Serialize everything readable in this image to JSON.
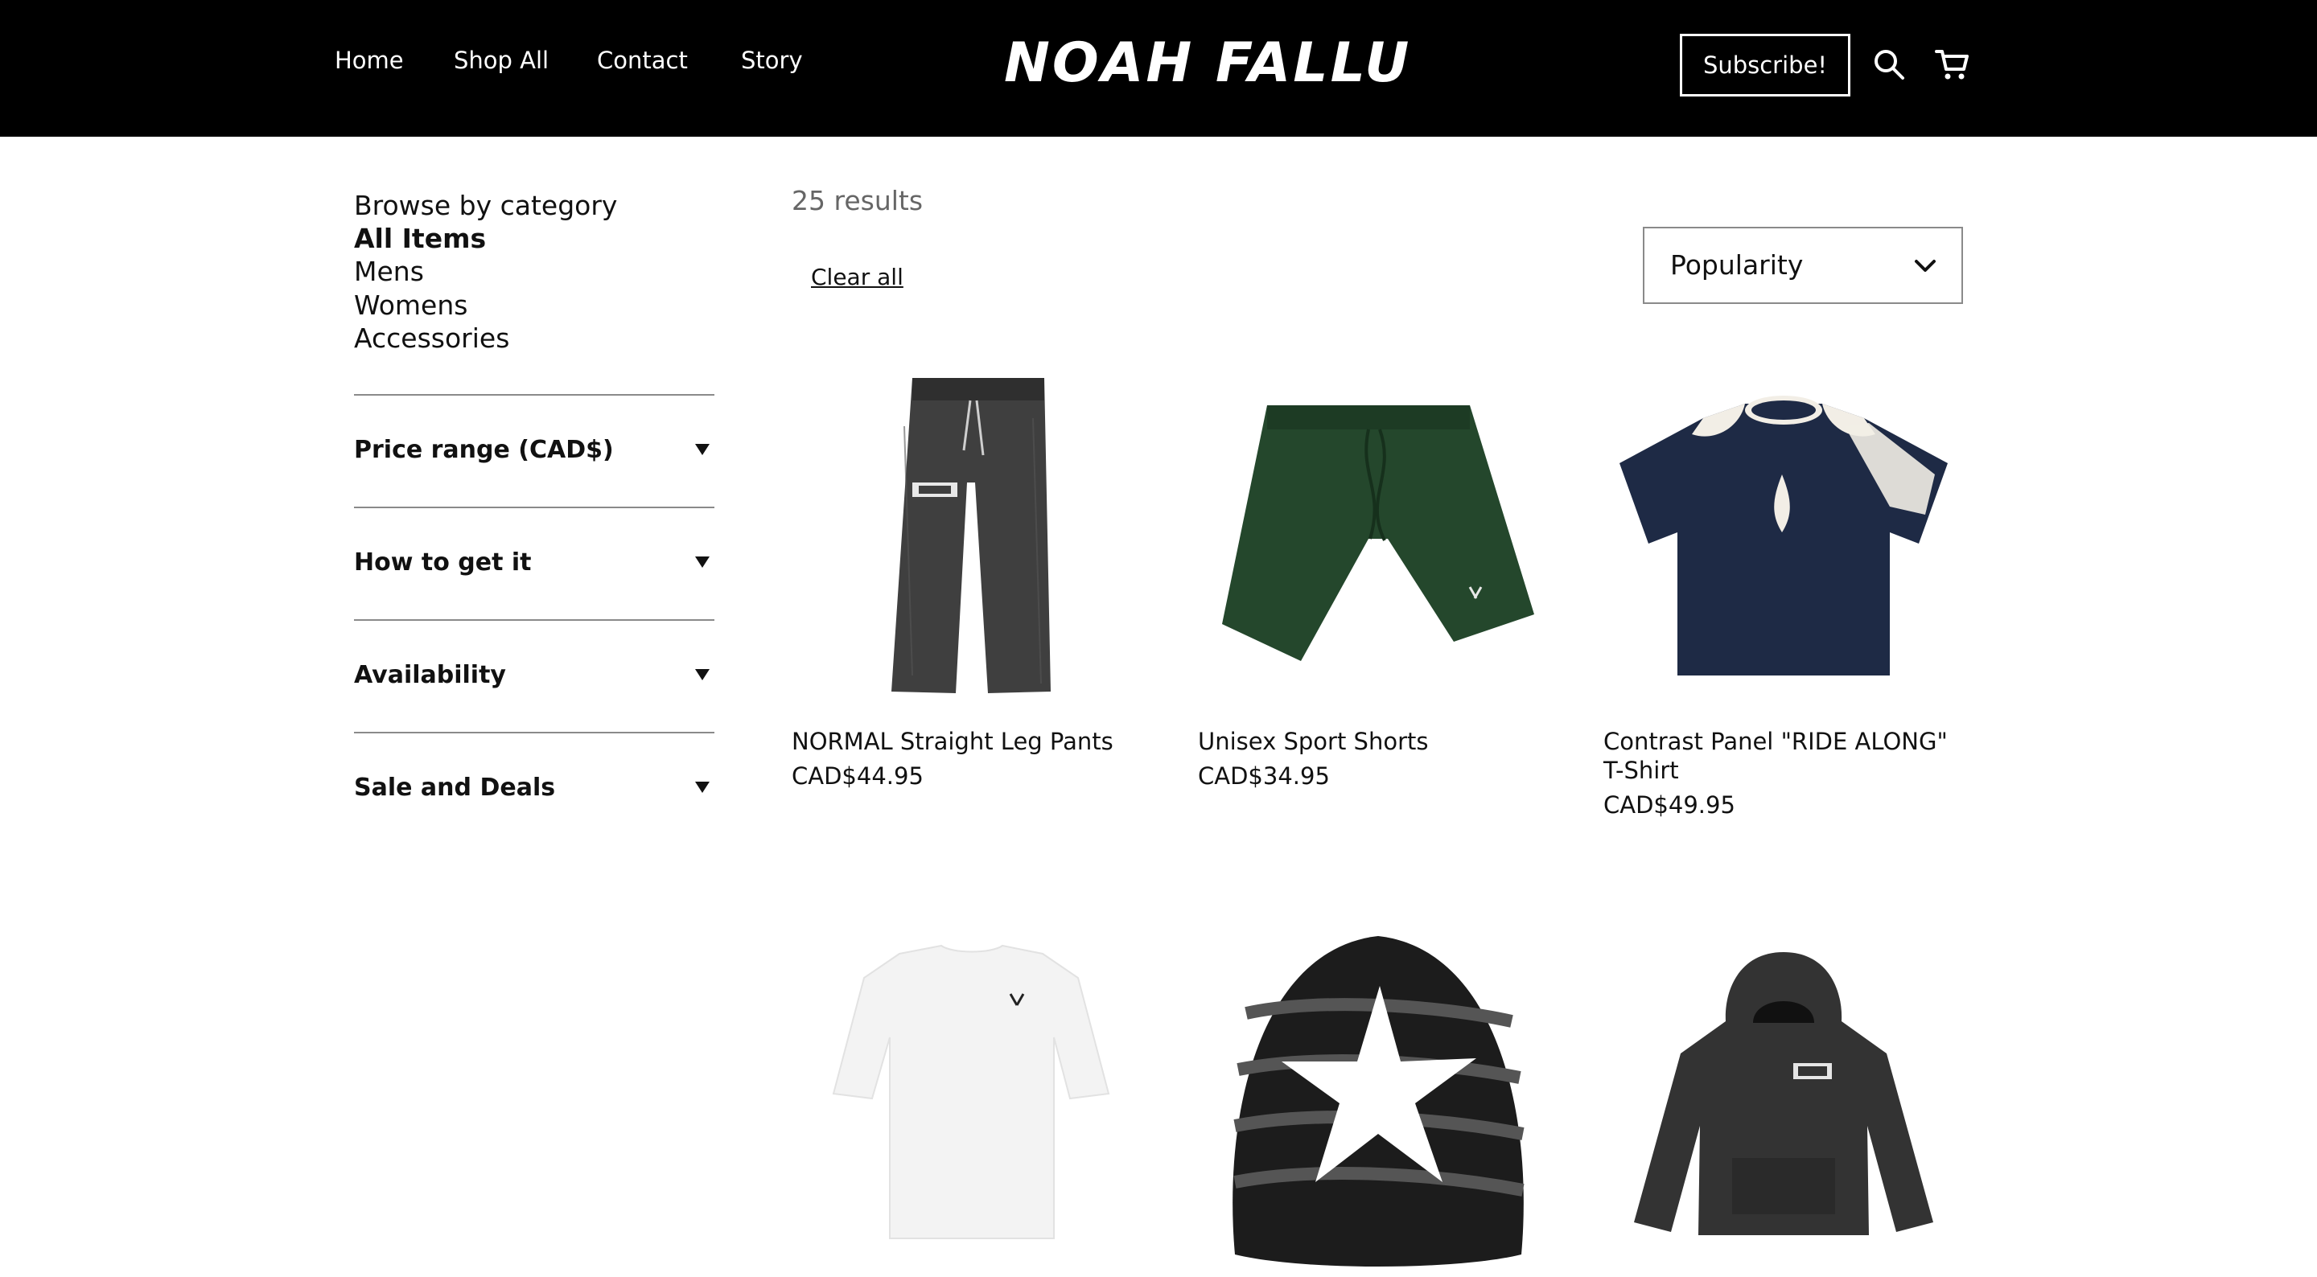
{
  "header": {
    "nav": [
      "Home",
      "Shop All",
      "Contact",
      "Story"
    ],
    "logo": "NOAH FALLU",
    "subscribe_label": "Subscribe!",
    "icons": [
      "search-icon",
      "cart-icon"
    ]
  },
  "sidebar": {
    "heading": "Browse by category",
    "categories": [
      {
        "label": "All Items",
        "active": true
      },
      {
        "label": "Mens",
        "active": false
      },
      {
        "label": "Womens",
        "active": false
      },
      {
        "label": "Accessories",
        "active": false
      }
    ],
    "filters": [
      "Price range (CAD$)",
      "How to get it",
      "Availability",
      "Sale and Deals"
    ]
  },
  "results": {
    "count_text": "25 results",
    "clear_all": "Clear all",
    "sort": {
      "selected": "Popularity"
    }
  },
  "products": [
    {
      "name": "NORMAL Straight Leg Pants",
      "price": "CAD$44.95",
      "image": "grey-washed-straight-leg-pants"
    },
    {
      "name": "Unisex Sport Shorts",
      "price": "CAD$34.95",
      "image": "dark-green-sport-shorts"
    },
    {
      "name": "Contrast Panel \"RIDE ALONG\" T-Shirt",
      "price": "CAD$49.95",
      "image": "navy-cream-contrast-tshirt"
    },
    {
      "name": "",
      "price": "",
      "image": "white-fitted-tshirt"
    },
    {
      "name": "",
      "price": "",
      "image": "black-striped-star-beanie"
    },
    {
      "name": "",
      "price": "",
      "image": "black-washed-nf-hoodie"
    }
  ],
  "colors": {
    "header_bg": "#000000",
    "text": "#111111",
    "muted": "#666666",
    "divider": "#8a8a8a"
  }
}
